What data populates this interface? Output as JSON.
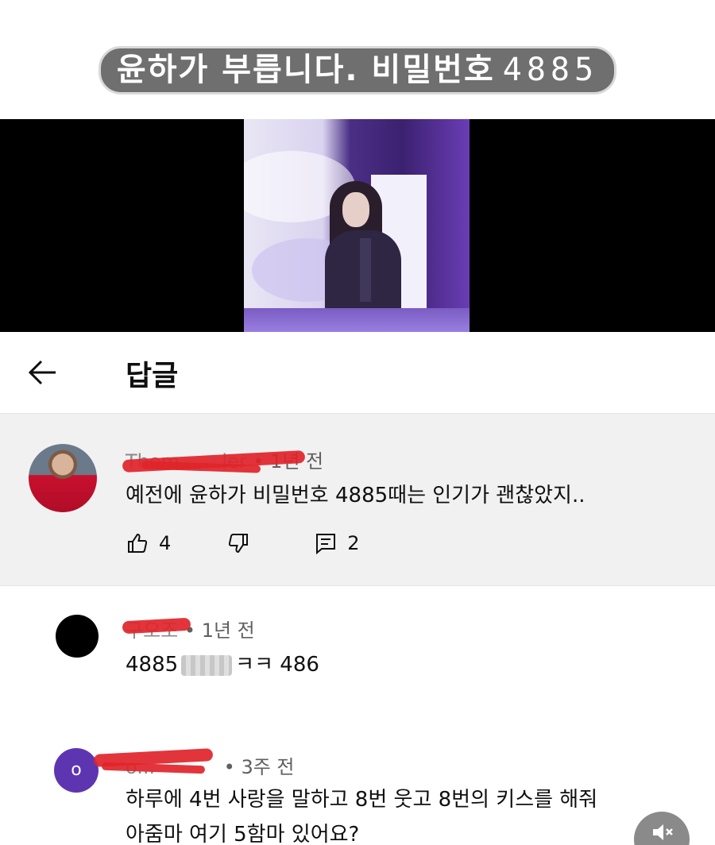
{
  "caption": {
    "text": "윤하가 부릅니다.  비밀번호",
    "password": "4885"
  },
  "header": {
    "title": "답글",
    "back_icon": "arrow-left-icon"
  },
  "main_comment": {
    "author": "Thom... ...ler",
    "time": "1년 전",
    "text": "예전에 윤하가 비밀번호 4885때는 인기가 괜찮았지..",
    "likes": "4",
    "replies": "2"
  },
  "replies": [
    {
      "author": "구오조",
      "time": "1년 전",
      "text_before": "4885",
      "text_after": "ㅋㅋ 486"
    },
    {
      "author": "o...",
      "avatar_letter": "o",
      "time": "3주 전",
      "line1": "하루에 4번 사랑을 말하고 8번 웃고 8번의 키스를 해줘",
      "line2": "아줌마 여기 5함마 있어요?"
    }
  ],
  "colors": {
    "accent": "#5e35b1",
    "redaction": "#e0242a",
    "caption_bg": "#6f6f6f"
  }
}
